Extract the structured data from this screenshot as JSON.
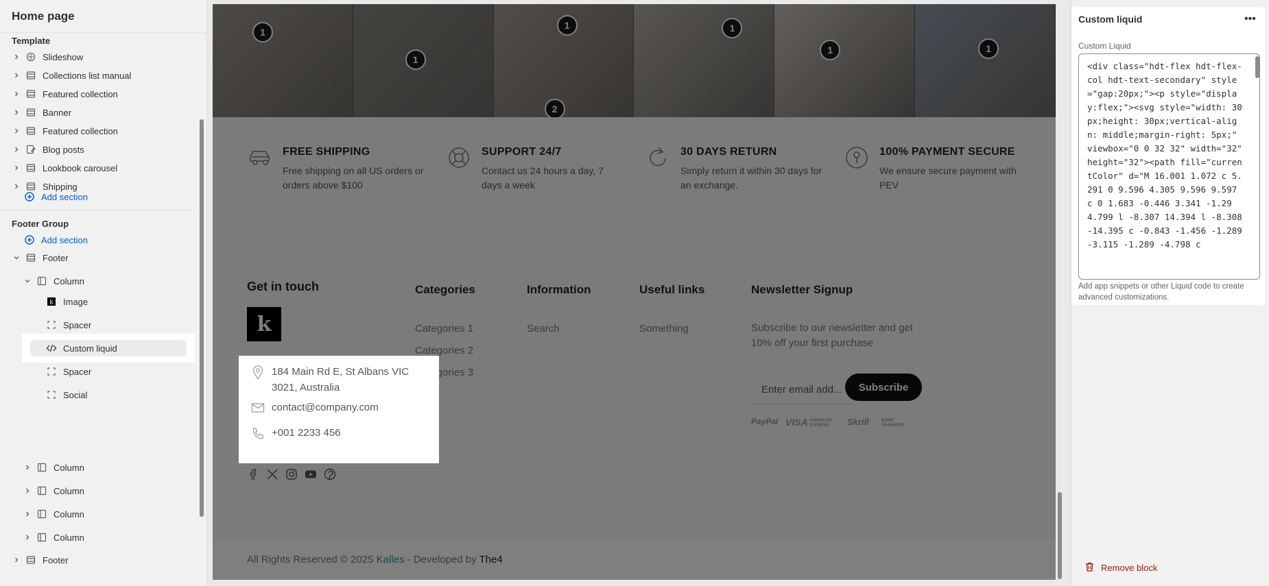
{
  "sidebar": {
    "title": "Home page",
    "template_label": "Template",
    "template_items": [
      {
        "label": "Slideshow",
        "icon": "slideshow-icon"
      },
      {
        "label": "Collections list manual",
        "icon": "section-icon"
      },
      {
        "label": "Featured collection",
        "icon": "section-icon"
      },
      {
        "label": "Banner",
        "icon": "section-icon"
      },
      {
        "label": "Featured collection",
        "icon": "section-icon"
      },
      {
        "label": "Blog posts",
        "icon": "blog-icon"
      },
      {
        "label": "Lookbook carousel",
        "icon": "section-icon"
      },
      {
        "label": "Shipping",
        "icon": "section-icon"
      }
    ],
    "add_section_label": "Add section",
    "footer_group_label": "Footer Group",
    "footer_add_section_label": "Add section",
    "footer_label": "Footer",
    "column_label": "Column",
    "column_children": [
      {
        "label": "Image",
        "icon": "image-icon"
      },
      {
        "label": "Spacer",
        "icon": "spacer-icon"
      },
      {
        "label": "Custom liquid",
        "icon": "code-icon"
      },
      {
        "label": "Spacer",
        "icon": "spacer-icon"
      },
      {
        "label": "Social",
        "icon": "spacer-icon"
      }
    ],
    "collapsed_columns": [
      "Column",
      "Column",
      "Column",
      "Column"
    ],
    "footer_bottom_label": "Footer"
  },
  "preview": {
    "hotspots": [
      "1",
      "1",
      "1",
      "2",
      "1",
      "1",
      "1"
    ],
    "features": [
      {
        "title": "FREE SHIPPING",
        "text": "Free shipping on all US orders or orders above $100",
        "icon": "car-icon"
      },
      {
        "title": "SUPPORT 24/7",
        "text": "Contact us 24 hours a day, 7 days a week",
        "icon": "lifebuoy-icon"
      },
      {
        "title": "30 DAYS RETURN",
        "text": "Simply return it within 30 days for an exchange.",
        "icon": "return-icon"
      },
      {
        "title": "100% PAYMENT SECURE",
        "text": "We ensure secure payment with PEV",
        "icon": "lock-icon"
      }
    ],
    "footer": {
      "get_in_touch": "Get in touch",
      "logo_letter": "k",
      "address": "184 Main Rd E, St Albans VIC 3021, Australia",
      "email": "contact@company.com",
      "phone": "+001 2233 456",
      "categories_title": "Categories",
      "categories": [
        "Categories 1",
        "Categories 2",
        "Categories 3"
      ],
      "information_title": "Information",
      "information": [
        "Search"
      ],
      "useful_title": "Useful links",
      "useful": [
        "Something"
      ],
      "newsletter_title": "Newsletter Signup",
      "newsletter_text": "Subscribe to our newsletter and get 10% off your first purchase",
      "email_placeholder": "Enter email add...",
      "subscribe_label": "Subscribe",
      "payments": [
        "PayPal",
        "VISA",
        "AMERICAN EXPRESS",
        "Skrill",
        "BANK TRANSFER"
      ]
    },
    "copyright": {
      "prefix": "All Rights Reserved © 2025 ",
      "brand": "Kalles",
      "middle": " - Developed by ",
      "developer": "The4"
    }
  },
  "panel": {
    "title": "Custom liquid",
    "field_label": "Custom Liquid",
    "code": "<div class=\"hdt-flex hdt-flex-col hdt-text-secondary\" style=\"gap:20px;\"><p style=\"display:flex;\"><svg style=\"width: 30px;height: 30px;vertical-align: middle;margin-right: 5px;\" viewbox=\"0 0 32 32\" width=\"32\" height=\"32\"><path fill=\"currentColor\" d=\"M 16.001 1.072 c 5.291 0 9.596 4.305 9.596 9.597 c 0 1.683 -0.446 3.341 -1.29 4.799 l -8.307 14.394 l -8.308 -14.395 c -0.843 -1.456 -1.289 -3.115 -1.289 -4.798 c",
    "help": "Add app snippets or other Liquid code to create advanced customizations.",
    "remove_label": "Remove block"
  },
  "colors": {
    "accent": "#005bd3",
    "brand_link": "#1d9aa8",
    "danger": "#8e1f0b"
  }
}
